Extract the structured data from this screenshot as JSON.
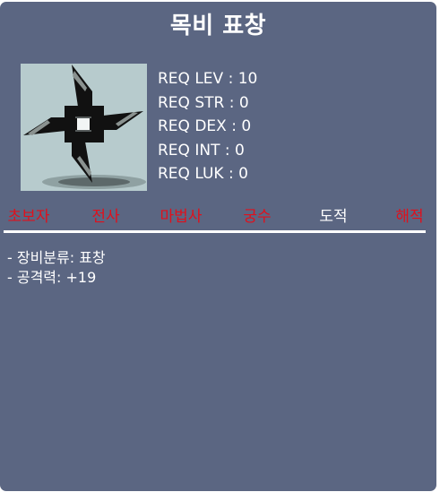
{
  "item": {
    "name": "목비 표창",
    "icon": "throwing-star-icon"
  },
  "requirements": [
    {
      "label": "REQ LEV : 10"
    },
    {
      "label": "REQ STR : 0"
    },
    {
      "label": "REQ DEX : 0"
    },
    {
      "label": "REQ INT : 0"
    },
    {
      "label": "REQ LUK : 0"
    }
  ],
  "jobs": [
    {
      "label": "초보자",
      "color": "#e0101c"
    },
    {
      "label": "전사",
      "color": "#e0101c"
    },
    {
      "label": "마법사",
      "color": "#e0101c"
    },
    {
      "label": "궁수",
      "color": "#e0101c"
    },
    {
      "label": "도적",
      "color": "#ffffff"
    },
    {
      "label": "해적",
      "color": "#e0101c"
    }
  ],
  "details": [
    {
      "text": "- 장비분류: 표창"
    },
    {
      "text": "- 공격력: +19"
    }
  ],
  "colors": {
    "background": "#5b6682",
    "icon_background": "#b7cbcd",
    "text": "#ffffff",
    "unavailable_job": "#e0101c"
  }
}
